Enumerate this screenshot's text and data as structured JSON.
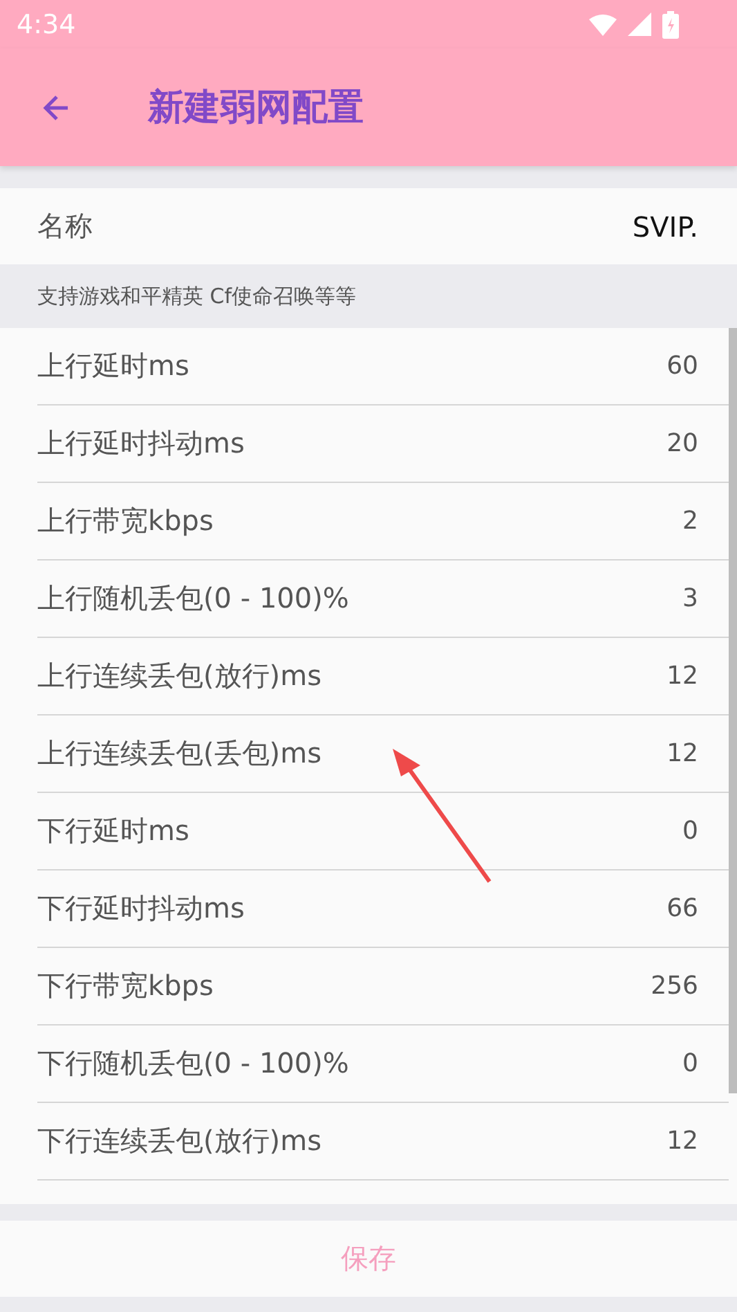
{
  "status_bar": {
    "time": "4:34"
  },
  "app_bar": {
    "title": "新建弱网配置"
  },
  "name_row": {
    "label": "名称",
    "value": "SVIP."
  },
  "note": "支持游戏和平精英 Cf使命召唤等等",
  "settings": [
    {
      "label": "上行延时ms",
      "value": "60"
    },
    {
      "label": "上行延时抖动ms",
      "value": "20"
    },
    {
      "label": "上行带宽kbps",
      "value": "2"
    },
    {
      "label": "上行随机丢包(0 - 100)%",
      "value": "3"
    },
    {
      "label": "上行连续丢包(放行)ms",
      "value": "12"
    },
    {
      "label": "上行连续丢包(丢包)ms",
      "value": "12"
    },
    {
      "label": "下行延时ms",
      "value": "0"
    },
    {
      "label": "下行延时抖动ms",
      "value": "66"
    },
    {
      "label": "下行带宽kbps",
      "value": "256"
    },
    {
      "label": "下行随机丢包(0 - 100)%",
      "value": "0"
    },
    {
      "label": "下行连续丢包(放行)ms",
      "value": "12"
    }
  ],
  "save_button": "保存"
}
